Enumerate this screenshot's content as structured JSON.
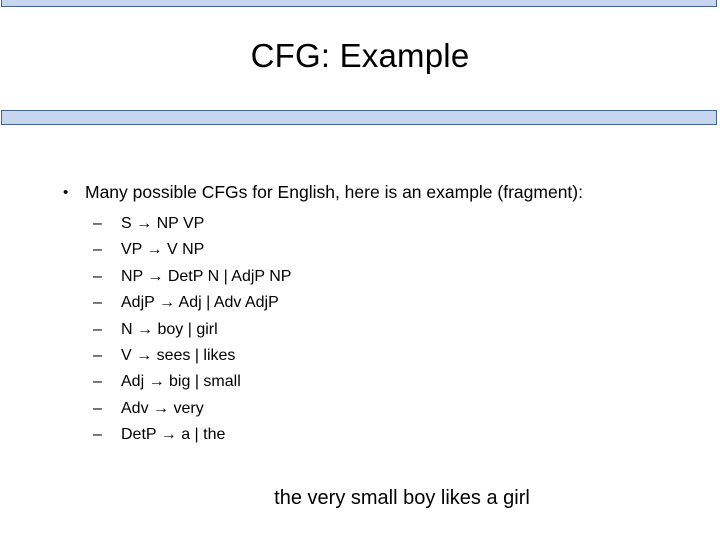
{
  "slide": {
    "title": "CFG: Example",
    "accent_fill": "#c5d6ee",
    "accent_stroke": "#44648c"
  },
  "body": {
    "bullet_marker": "•",
    "bullet_text": "Many possible CFGs for English, here is an example (fragment):",
    "sub_marker": "–",
    "arrow": "→",
    "rules": [
      {
        "lhs": "S",
        "rhs": "NP VP"
      },
      {
        "lhs": "VP",
        "rhs": " V NP"
      },
      {
        "lhs": "NP",
        "rhs": "DetP N | AdjP NP"
      },
      {
        "lhs": "AdjP",
        "rhs": " Adj | Adv AdjP"
      },
      {
        "lhs": "N",
        "rhs": " boy | girl"
      },
      {
        "lhs": "V",
        "rhs": " sees | likes"
      },
      {
        "lhs": "Adj",
        "rhs": " big | small"
      },
      {
        "lhs": "Adv",
        "rhs": " very"
      },
      {
        "lhs": "DetP",
        "rhs": " a | the"
      }
    ],
    "derived_sentence": "the very small boy likes a girl"
  }
}
